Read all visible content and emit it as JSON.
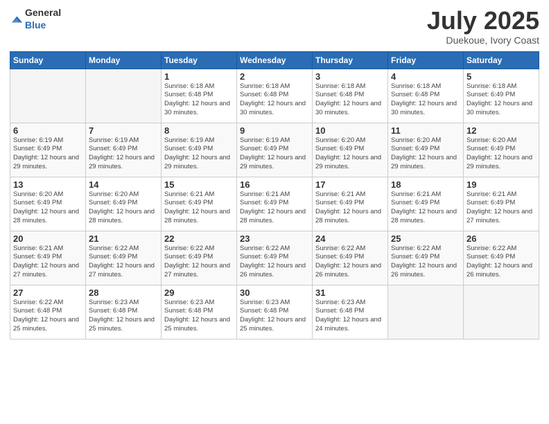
{
  "logo": {
    "text_general": "General",
    "text_blue": "Blue"
  },
  "header": {
    "month": "July 2025",
    "location": "Duekoue, Ivory Coast"
  },
  "weekdays": [
    "Sunday",
    "Monday",
    "Tuesday",
    "Wednesday",
    "Thursday",
    "Friday",
    "Saturday"
  ],
  "weeks": [
    [
      {
        "day": "",
        "empty": true
      },
      {
        "day": "",
        "empty": true
      },
      {
        "day": "1",
        "sunrise": "Sunrise: 6:18 AM",
        "sunset": "Sunset: 6:48 PM",
        "daylight": "Daylight: 12 hours and 30 minutes."
      },
      {
        "day": "2",
        "sunrise": "Sunrise: 6:18 AM",
        "sunset": "Sunset: 6:48 PM",
        "daylight": "Daylight: 12 hours and 30 minutes."
      },
      {
        "day": "3",
        "sunrise": "Sunrise: 6:18 AM",
        "sunset": "Sunset: 6:48 PM",
        "daylight": "Daylight: 12 hours and 30 minutes."
      },
      {
        "day": "4",
        "sunrise": "Sunrise: 6:18 AM",
        "sunset": "Sunset: 6:48 PM",
        "daylight": "Daylight: 12 hours and 30 minutes."
      },
      {
        "day": "5",
        "sunrise": "Sunrise: 6:18 AM",
        "sunset": "Sunset: 6:49 PM",
        "daylight": "Daylight: 12 hours and 30 minutes."
      }
    ],
    [
      {
        "day": "6",
        "sunrise": "Sunrise: 6:19 AM",
        "sunset": "Sunset: 6:49 PM",
        "daylight": "Daylight: 12 hours and 29 minutes."
      },
      {
        "day": "7",
        "sunrise": "Sunrise: 6:19 AM",
        "sunset": "Sunset: 6:49 PM",
        "daylight": "Daylight: 12 hours and 29 minutes."
      },
      {
        "day": "8",
        "sunrise": "Sunrise: 6:19 AM",
        "sunset": "Sunset: 6:49 PM",
        "daylight": "Daylight: 12 hours and 29 minutes."
      },
      {
        "day": "9",
        "sunrise": "Sunrise: 6:19 AM",
        "sunset": "Sunset: 6:49 PM",
        "daylight": "Daylight: 12 hours and 29 minutes."
      },
      {
        "day": "10",
        "sunrise": "Sunrise: 6:20 AM",
        "sunset": "Sunset: 6:49 PM",
        "daylight": "Daylight: 12 hours and 29 minutes."
      },
      {
        "day": "11",
        "sunrise": "Sunrise: 6:20 AM",
        "sunset": "Sunset: 6:49 PM",
        "daylight": "Daylight: 12 hours and 29 minutes."
      },
      {
        "day": "12",
        "sunrise": "Sunrise: 6:20 AM",
        "sunset": "Sunset: 6:49 PM",
        "daylight": "Daylight: 12 hours and 29 minutes."
      }
    ],
    [
      {
        "day": "13",
        "sunrise": "Sunrise: 6:20 AM",
        "sunset": "Sunset: 6:49 PM",
        "daylight": "Daylight: 12 hours and 28 minutes."
      },
      {
        "day": "14",
        "sunrise": "Sunrise: 6:20 AM",
        "sunset": "Sunset: 6:49 PM",
        "daylight": "Daylight: 12 hours and 28 minutes."
      },
      {
        "day": "15",
        "sunrise": "Sunrise: 6:21 AM",
        "sunset": "Sunset: 6:49 PM",
        "daylight": "Daylight: 12 hours and 28 minutes."
      },
      {
        "day": "16",
        "sunrise": "Sunrise: 6:21 AM",
        "sunset": "Sunset: 6:49 PM",
        "daylight": "Daylight: 12 hours and 28 minutes."
      },
      {
        "day": "17",
        "sunrise": "Sunrise: 6:21 AM",
        "sunset": "Sunset: 6:49 PM",
        "daylight": "Daylight: 12 hours and 28 minutes."
      },
      {
        "day": "18",
        "sunrise": "Sunrise: 6:21 AM",
        "sunset": "Sunset: 6:49 PM",
        "daylight": "Daylight: 12 hours and 28 minutes."
      },
      {
        "day": "19",
        "sunrise": "Sunrise: 6:21 AM",
        "sunset": "Sunset: 6:49 PM",
        "daylight": "Daylight: 12 hours and 27 minutes."
      }
    ],
    [
      {
        "day": "20",
        "sunrise": "Sunrise: 6:21 AM",
        "sunset": "Sunset: 6:49 PM",
        "daylight": "Daylight: 12 hours and 27 minutes."
      },
      {
        "day": "21",
        "sunrise": "Sunrise: 6:22 AM",
        "sunset": "Sunset: 6:49 PM",
        "daylight": "Daylight: 12 hours and 27 minutes."
      },
      {
        "day": "22",
        "sunrise": "Sunrise: 6:22 AM",
        "sunset": "Sunset: 6:49 PM",
        "daylight": "Daylight: 12 hours and 27 minutes."
      },
      {
        "day": "23",
        "sunrise": "Sunrise: 6:22 AM",
        "sunset": "Sunset: 6:49 PM",
        "daylight": "Daylight: 12 hours and 26 minutes."
      },
      {
        "day": "24",
        "sunrise": "Sunrise: 6:22 AM",
        "sunset": "Sunset: 6:49 PM",
        "daylight": "Daylight: 12 hours and 26 minutes."
      },
      {
        "day": "25",
        "sunrise": "Sunrise: 6:22 AM",
        "sunset": "Sunset: 6:49 PM",
        "daylight": "Daylight: 12 hours and 26 minutes."
      },
      {
        "day": "26",
        "sunrise": "Sunrise: 6:22 AM",
        "sunset": "Sunset: 6:49 PM",
        "daylight": "Daylight: 12 hours and 26 minutes."
      }
    ],
    [
      {
        "day": "27",
        "sunrise": "Sunrise: 6:22 AM",
        "sunset": "Sunset: 6:48 PM",
        "daylight": "Daylight: 12 hours and 25 minutes."
      },
      {
        "day": "28",
        "sunrise": "Sunrise: 6:23 AM",
        "sunset": "Sunset: 6:48 PM",
        "daylight": "Daylight: 12 hours and 25 minutes."
      },
      {
        "day": "29",
        "sunrise": "Sunrise: 6:23 AM",
        "sunset": "Sunset: 6:48 PM",
        "daylight": "Daylight: 12 hours and 25 minutes."
      },
      {
        "day": "30",
        "sunrise": "Sunrise: 6:23 AM",
        "sunset": "Sunset: 6:48 PM",
        "daylight": "Daylight: 12 hours and 25 minutes."
      },
      {
        "day": "31",
        "sunrise": "Sunrise: 6:23 AM",
        "sunset": "Sunset: 6:48 PM",
        "daylight": "Daylight: 12 hours and 24 minutes."
      },
      {
        "day": "",
        "empty": true
      },
      {
        "day": "",
        "empty": true
      }
    ]
  ]
}
